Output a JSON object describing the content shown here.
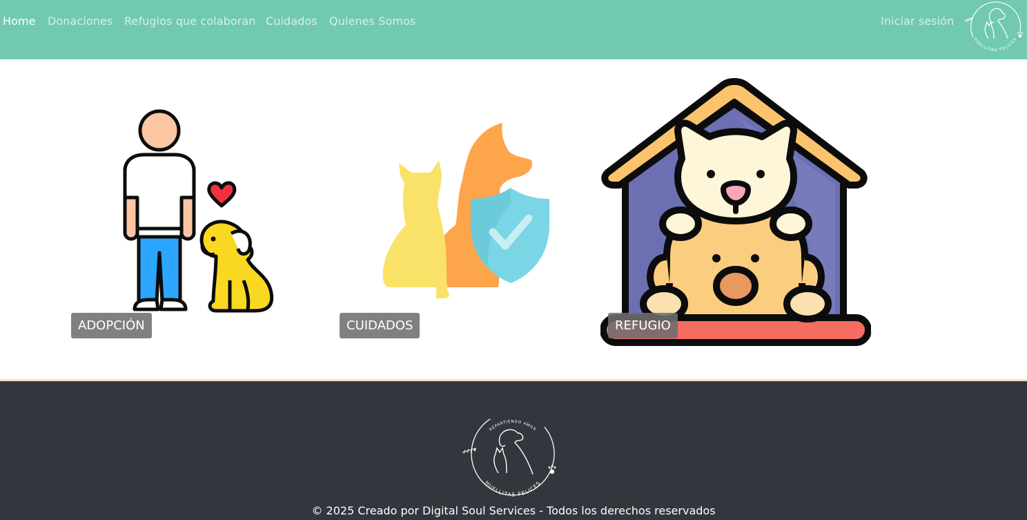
{
  "nav": {
    "items": [
      {
        "label": "Home",
        "active": true
      },
      {
        "label": "Donaciones",
        "active": false
      },
      {
        "label": "Refugios que colaboran",
        "active": false
      },
      {
        "label": "Cuidados",
        "active": false
      },
      {
        "label": "Quienes Somos",
        "active": false
      }
    ],
    "login_label": "Iniciar sesión",
    "logo_icon": "huellitas-felices-logo-icon",
    "logo_text": "HUELLITAS FELICES"
  },
  "cards": [
    {
      "label": "ADOPCIÓN",
      "icon": "person-with-dog-icon"
    },
    {
      "label": "CUIDADOS",
      "icon": "pets-shield-check-icon"
    },
    {
      "label": "REFUGIO",
      "icon": "pet-house-icon"
    }
  ],
  "footer": {
    "logo_icon": "huellitas-felices-logo-icon",
    "logo_top_text": "REPARTIENDO AMOR",
    "logo_bottom_text": "HUELLITAS FELICES",
    "copyright": "© 2025 Creado por Digital Soul Services - Todos los derechos reservados"
  },
  "colors": {
    "navbar": "#71c9b0",
    "footer": "#33363c",
    "footer_border": "#f6dfc4",
    "badge": "#6e6e6e"
  }
}
